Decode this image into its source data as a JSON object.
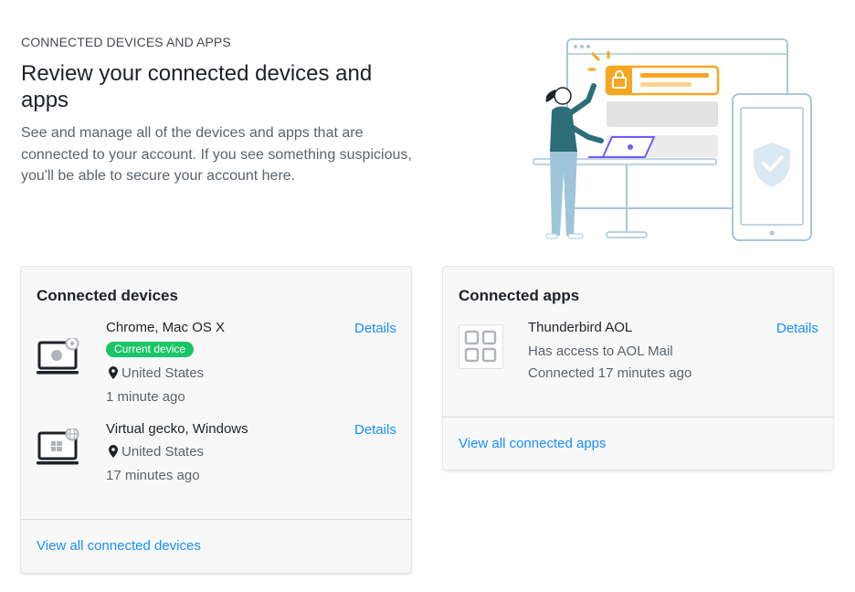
{
  "header": {
    "eyebrow": "CONNECTED DEVICES AND APPS",
    "title": "Review your connected devices and apps",
    "description": "See and manage all of the devices and apps that are connected to your account. If you see something suspicious, you'll be able to secure your account here."
  },
  "illustration": {
    "icon_names": [
      "browser-window-icon",
      "lock-icon",
      "tablet-icon",
      "shield-check-icon",
      "person-icon",
      "laptop-icon"
    ],
    "colors": {
      "accent_orange": "#f5a623",
      "line_blue": "#a9c6d8",
      "person_teal": "#2d6d78",
      "person_pants": "#9ec5d9",
      "laptop_purple": "#7759ff"
    }
  },
  "devices_card": {
    "title": "Connected devices",
    "devices": [
      {
        "name": "Chrome, Mac OS X",
        "badge": "Current device",
        "location": "United States",
        "time": "1 minute ago",
        "details_label": "Details",
        "icon": "laptop-chrome-apple-icon"
      },
      {
        "name": "Virtual gecko, Windows",
        "location": "United States",
        "time": "17 minutes ago",
        "details_label": "Details",
        "icon": "laptop-globe-windows-icon"
      }
    ],
    "footer_link": "View all connected devices"
  },
  "apps_card": {
    "title": "Connected apps",
    "apps": [
      {
        "name": "Thunderbird AOL",
        "access": "Has access to AOL Mail",
        "time": "Connected 17 minutes ago",
        "details_label": "Details",
        "icon": "app-grid-icon"
      }
    ],
    "footer_link": "View all connected apps"
  },
  "colors": {
    "link": "#188fff",
    "badge_green": "#1ac567",
    "card_bg": "#f8f8f8"
  }
}
